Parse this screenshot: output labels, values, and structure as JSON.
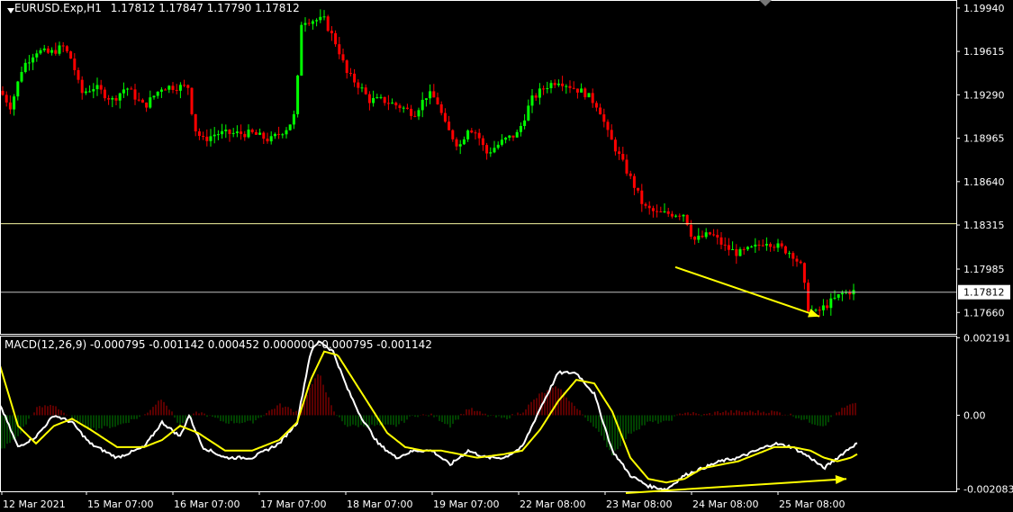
{
  "header": {
    "symbol_tf": "EURUSD.Exp,H1",
    "ohlc": "1.17812 1.17847 1.17790 1.17812"
  },
  "macd_header": "MACD(12,26,9) -0.000795 -0.001142 0.000452 0.000000 -0.000795 -0.001142",
  "colors": {
    "background": "#000000",
    "bull_candle": "#00ff00",
    "bear_candle": "#ff0000",
    "macd_line": "#ffffff",
    "signal_line": "#ffff00",
    "hist_pos": "#8b0000",
    "hist_neg": "#006400",
    "arrow": "#ffff00",
    "hline": "#f5f5a0",
    "axis": "#ffffff"
  },
  "chart_data": [
    {
      "type": "candlestick",
      "title": "EURUSD.Exp,H1",
      "ylim": [
        1.175,
        1.2
      ],
      "y_ticks": [
        "1.19940",
        "1.19615",
        "1.19290",
        "1.18965",
        "1.18640",
        "1.18315",
        "1.17985",
        "1.17660"
      ],
      "current_price": "1.17812",
      "hlines": [
        1.18325,
        1.17812
      ],
      "x_ticks": [
        "12 Mar 2021",
        "15 Mar 07:00",
        "16 Mar 07:00",
        "17 Mar 07:00",
        "18 Mar 07:00",
        "19 Mar 07:00",
        "22 Mar 08:00",
        "23 Mar 08:00",
        "24 Mar 08:00",
        "25 Mar 08:00"
      ],
      "path_estimate": [
        [
          0,
          1.1932
        ],
        [
          12,
          1.192
        ],
        [
          25,
          1.195
        ],
        [
          40,
          1.1962
        ],
        [
          55,
          1.196
        ],
        [
          70,
          1.1965
        ],
        [
          80,
          1.1955
        ],
        [
          90,
          1.193
        ],
        [
          105,
          1.1935
        ],
        [
          125,
          1.1925
        ],
        [
          140,
          1.1935
        ],
        [
          160,
          1.192
        ],
        [
          180,
          1.1935
        ],
        [
          200,
          1.1935
        ],
        [
          210,
          1.1935
        ],
        [
          215,
          1.1905
        ],
        [
          225,
          1.1895
        ],
        [
          240,
          1.19
        ],
        [
          260,
          1.19
        ],
        [
          280,
          1.19
        ],
        [
          300,
          1.1895
        ],
        [
          320,
          1.1905
        ],
        [
          328,
          1.1915
        ],
        [
          335,
          1.1985
        ],
        [
          345,
          1.1985
        ],
        [
          360,
          1.1985
        ],
        [
          375,
          1.1965
        ],
        [
          385,
          1.1945
        ],
        [
          400,
          1.1935
        ],
        [
          410,
          1.1925
        ],
        [
          425,
          1.1925
        ],
        [
          445,
          1.192
        ],
        [
          460,
          1.1915
        ],
        [
          475,
          1.193
        ],
        [
          485,
          1.1925
        ],
        [
          495,
          1.1905
        ],
        [
          510,
          1.189
        ],
        [
          520,
          1.1905
        ],
        [
          530,
          1.19
        ],
        [
          540,
          1.1885
        ],
        [
          550,
          1.189
        ],
        [
          560,
          1.1895
        ],
        [
          575,
          1.19
        ],
        [
          590,
          1.1925
        ],
        [
          605,
          1.1935
        ],
        [
          620,
          1.194
        ],
        [
          635,
          1.1935
        ],
        [
          650,
          1.193
        ],
        [
          665,
          1.192
        ],
        [
          675,
          1.19
        ],
        [
          690,
          1.188
        ],
        [
          705,
          1.186
        ],
        [
          715,
          1.1845
        ],
        [
          730,
          1.184
        ],
        [
          745,
          1.184
        ],
        [
          760,
          1.184
        ],
        [
          770,
          1.182
        ],
        [
          790,
          1.1825
        ],
        [
          805,
          1.1815
        ],
        [
          820,
          1.181
        ],
        [
          840,
          1.1815
        ],
        [
          850,
          1.182
        ],
        [
          865,
          1.1815
        ],
        [
          880,
          1.181
        ],
        [
          890,
          1.18
        ],
        [
          897,
          1.177
        ],
        [
          905,
          1.1765
        ],
        [
          915,
          1.177
        ],
        [
          925,
          1.1775
        ],
        [
          935,
          1.178
        ],
        [
          945,
          1.1782
        ],
        [
          952,
          1.1781
        ]
      ],
      "annotations": [
        {
          "type": "arrow",
          "from": [
            750,
            1.18
          ],
          "to": [
            910,
            1.1763
          ]
        }
      ]
    },
    {
      "type": "line",
      "title": "MACD(12,26,9)",
      "ylim": [
        -0.00215,
        0.00225
      ],
      "y_ticks": [
        "0.002191",
        "0.00",
        "-0.002083"
      ],
      "series": [
        {
          "values": [
            [
              0,
              0.0003
            ],
            [
              20,
              -0.0009
            ],
            [
              40,
              -0.0006
            ],
            [
              60,
              0.0
            ],
            [
              80,
              -0.0002
            ],
            [
              100,
              -0.0008
            ],
            [
              130,
              -0.0012
            ],
            [
              160,
              -0.0009
            ],
            [
              180,
              -0.0002
            ],
            [
              200,
              -0.0006
            ],
            [
              210,
              0.0
            ],
            [
              225,
              -0.0009
            ],
            [
              250,
              -0.0012
            ],
            [
              280,
              -0.0012
            ],
            [
              310,
              -0.0008
            ],
            [
              330,
              -0.0002
            ],
            [
              345,
              0.0018
            ],
            [
              355,
              0.0021
            ],
            [
              370,
              0.0018
            ],
            [
              385,
              0.0008
            ],
            [
              400,
              0.0
            ],
            [
              420,
              -0.0008
            ],
            [
              440,
              -0.0012
            ],
            [
              460,
              -0.001
            ],
            [
              480,
              -0.001
            ],
            [
              500,
              -0.0014
            ],
            [
              520,
              -0.001
            ],
            [
              540,
              -0.0012
            ],
            [
              560,
              -0.0012
            ],
            [
              580,
              -0.0009
            ],
            [
              600,
              0.0002
            ],
            [
              620,
              0.0012
            ],
            [
              640,
              0.0012
            ],
            [
              660,
              0.0006
            ],
            [
              680,
              -0.001
            ],
            [
              700,
              -0.0017
            ],
            [
              720,
              -0.002
            ],
            [
              740,
              -0.0021
            ],
            [
              760,
              -0.0017
            ],
            [
              780,
              -0.0015
            ],
            [
              800,
              -0.0013
            ],
            [
              820,
              -0.0012
            ],
            [
              840,
              -0.001
            ],
            [
              860,
              -0.0008
            ],
            [
              880,
              -0.0009
            ],
            [
              900,
              -0.0012
            ],
            [
              915,
              -0.0015
            ],
            [
              930,
              -0.0012
            ],
            [
              945,
              -0.0009
            ],
            [
              952,
              -0.0008
            ]
          ]
        },
        {
          "values": [
            [
              0,
              0.0014
            ],
            [
              20,
              -0.0003
            ],
            [
              40,
              -0.0008
            ],
            [
              60,
              -0.0003
            ],
            [
              80,
              -0.0001
            ],
            [
              100,
              -0.0004
            ],
            [
              130,
              -0.0009
            ],
            [
              160,
              -0.0009
            ],
            [
              180,
              -0.0007
            ],
            [
              200,
              -0.0003
            ],
            [
              220,
              -0.0005
            ],
            [
              250,
              -0.001
            ],
            [
              280,
              -0.001
            ],
            [
              310,
              -0.0007
            ],
            [
              330,
              -0.0002
            ],
            [
              345,
              0.001
            ],
            [
              360,
              0.0018
            ],
            [
              375,
              0.0017
            ],
            [
              390,
              0.0011
            ],
            [
              410,
              0.0003
            ],
            [
              430,
              -0.0005
            ],
            [
              450,
              -0.0009
            ],
            [
              470,
              -0.001
            ],
            [
              490,
              -0.001
            ],
            [
              510,
              -0.0011
            ],
            [
              530,
              -0.0012
            ],
            [
              560,
              -0.0011
            ],
            [
              580,
              -0.001
            ],
            [
              600,
              -0.0004
            ],
            [
              620,
              0.0004
            ],
            [
              640,
              0.001
            ],
            [
              660,
              0.0009
            ],
            [
              680,
              0.0001
            ],
            [
              700,
              -0.0012
            ],
            [
              720,
              -0.0018
            ],
            [
              740,
              -0.0019
            ],
            [
              760,
              -0.0018
            ],
            [
              780,
              -0.0015
            ],
            [
              800,
              -0.0014
            ],
            [
              820,
              -0.0013
            ],
            [
              840,
              -0.0011
            ],
            [
              860,
              -0.0009
            ],
            [
              880,
              -0.0009
            ],
            [
              900,
              -0.001
            ],
            [
              915,
              -0.0012
            ],
            [
              930,
              -0.0013
            ],
            [
              945,
              -0.0012
            ],
            [
              952,
              -0.0011
            ]
          ]
        }
      ],
      "histogram_estimate": [
        [
          0,
          -0.001
        ],
        [
          20,
          -0.0006
        ],
        [
          40,
          0.0002
        ],
        [
          60,
          0.0003
        ],
        [
          80,
          -0.0001
        ],
        [
          100,
          -0.0004
        ],
        [
          130,
          -0.0003
        ],
        [
          160,
          0.0
        ],
        [
          180,
          0.0005
        ],
        [
          200,
          -0.0003
        ],
        [
          220,
          0.0001
        ],
        [
          250,
          -0.0002
        ],
        [
          280,
          -0.0002
        ],
        [
          310,
          0.0003
        ],
        [
          330,
          0.0001
        ],
        [
          345,
          0.0008
        ],
        [
          355,
          0.0012
        ],
        [
          370,
          0.0001
        ],
        [
          385,
          -0.0003
        ],
        [
          400,
          -0.0003
        ],
        [
          420,
          -0.0003
        ],
        [
          440,
          -0.0003
        ],
        [
          460,
          0.0
        ],
        [
          480,
          0.0
        ],
        [
          500,
          -0.0003
        ],
        [
          520,
          0.0002
        ],
        [
          540,
          0.0
        ],
        [
          560,
          -0.0001
        ],
        [
          580,
          0.0001
        ],
        [
          600,
          0.0006
        ],
        [
          620,
          0.0008
        ],
        [
          640,
          0.0002
        ],
        [
          660,
          -0.0003
        ],
        [
          680,
          -0.0011
        ],
        [
          700,
          -0.0005
        ],
        [
          720,
          -0.0002
        ],
        [
          740,
          -0.0002
        ],
        [
          760,
          0.0001
        ],
        [
          780,
          0.0
        ],
        [
          800,
          0.0001
        ],
        [
          820,
          0.0001
        ],
        [
          840,
          0.0001
        ],
        [
          860,
          0.0001
        ],
        [
          880,
          0.0
        ],
        [
          900,
          -0.0002
        ],
        [
          915,
          -0.0003
        ],
        [
          930,
          0.0001
        ],
        [
          945,
          0.0003
        ],
        [
          952,
          0.0003
        ]
      ],
      "annotations": [
        {
          "type": "arrow",
          "from": [
            695,
            -0.0022
          ],
          "to": [
            940,
            -0.0018
          ]
        }
      ]
    }
  ]
}
